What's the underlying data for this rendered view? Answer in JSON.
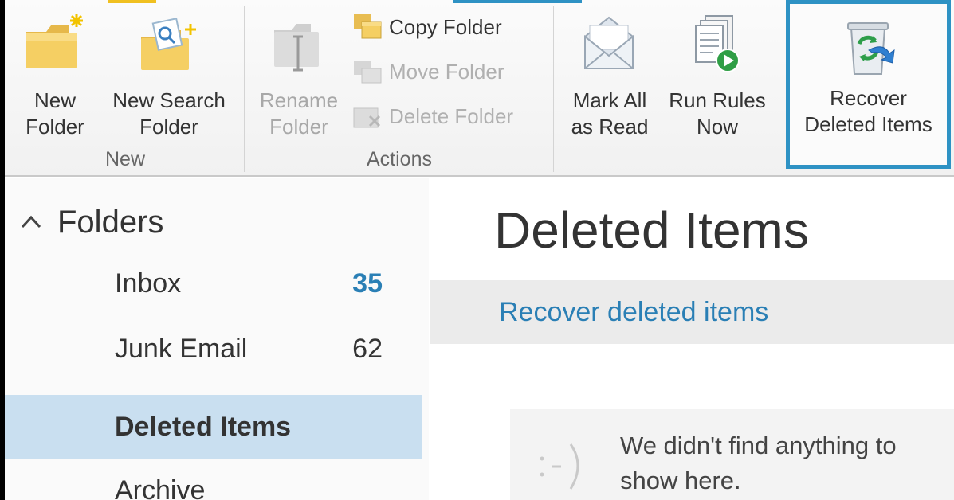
{
  "colors": {
    "accent": "#2e92c4",
    "link": "#2a7fb5",
    "selected_bg": "#c9dff0",
    "ribbon_bg": "#f4f4f4"
  },
  "ribbon": {
    "groups": {
      "new": {
        "label": "New",
        "new_folder": {
          "icon": "new-folder-icon",
          "line1": "New",
          "line2": "Folder"
        },
        "new_search_folder": {
          "icon": "new-search-folder-icon",
          "line1": "New Search",
          "line2": "Folder"
        }
      },
      "actions": {
        "label": "Actions",
        "rename_folder": {
          "icon": "rename-folder-icon",
          "line1": "Rename",
          "line2": "Folder",
          "enabled": false
        },
        "copy_folder": {
          "icon": "copy-folder-icon",
          "label": "Copy Folder",
          "enabled": true
        },
        "move_folder": {
          "icon": "move-folder-icon",
          "label": "Move Folder",
          "enabled": false
        },
        "delete_folder": {
          "icon": "delete-folder-icon",
          "label": "Delete Folder",
          "enabled": false
        }
      },
      "clean_up": {
        "mark_all_read": {
          "icon": "mark-all-read-icon",
          "line1": "Mark All",
          "line2": "as Read"
        },
        "run_rules": {
          "icon": "run-rules-icon",
          "line1": "Run Rules",
          "line2": "Now"
        },
        "recover_deleted": {
          "icon": "recycle-bin-icon",
          "line1": "Recover",
          "line2": "Deleted Items"
        }
      }
    }
  },
  "nav": {
    "folders_header": "Folders",
    "folders": [
      {
        "name": "Inbox",
        "count": "35",
        "unread": true
      },
      {
        "name": "Junk Email",
        "count": "62",
        "unread": false
      },
      {
        "name": "Deleted Items",
        "count": "",
        "selected": true
      },
      {
        "name": "Archive",
        "count": ""
      }
    ]
  },
  "main": {
    "title": "Deleted Items",
    "recover_link": "Recover deleted items",
    "empty_face": ":-)",
    "empty_message": "We didn't find anything to show here."
  }
}
